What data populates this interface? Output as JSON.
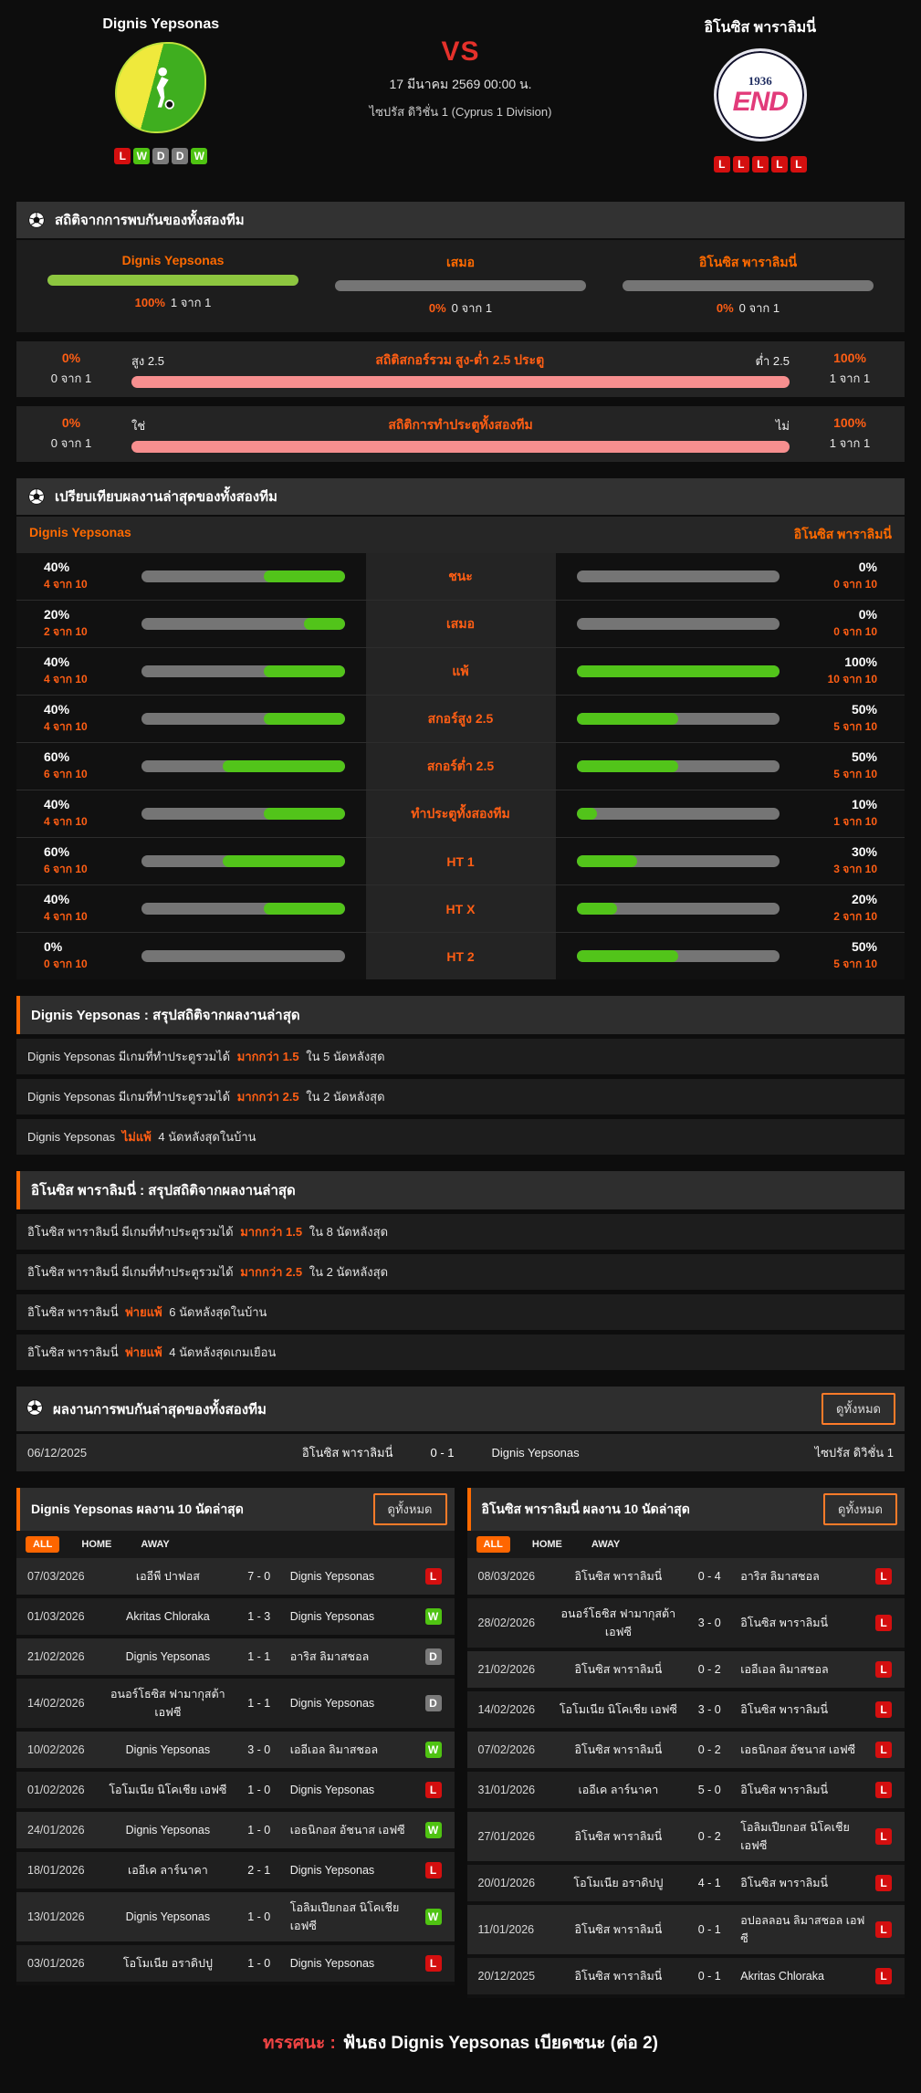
{
  "colors": {
    "accent": "#ff6a00",
    "green": "#52c41a",
    "green_light": "#8dc63f",
    "gray_bar": "#757575",
    "pink": "#f78f8f",
    "win": "#4fc312",
    "loss": "#d40f0f",
    "draw": "#7a7a7a",
    "vs_red": "#e5312b"
  },
  "header": {
    "home": {
      "name": "Dignis Yepsonas",
      "form": [
        "L",
        "W",
        "D",
        "D",
        "W"
      ]
    },
    "away": {
      "name": "อิโนซิส พาราลิมนี่",
      "form": [
        "L",
        "L",
        "L",
        "L",
        "L"
      ],
      "logo_year": "1936",
      "logo_text": "END"
    },
    "vs": "VS",
    "datetime": "17 มีนาคม 2569 00:00 น.",
    "league": "ไซปรัส ดิวิชั่น 1 (Cyprus 1 Division)"
  },
  "h2h_stats": {
    "title": "สถิติจากการพบกันของทั้งสองทีม",
    "columns": [
      {
        "label": "Dignis Yepsonas",
        "pct": "100%",
        "count": "1 จาก 1",
        "fill": 100,
        "fill_color": "#8dc63f"
      },
      {
        "label": "เสมอ",
        "pct": "0%",
        "count": "0 จาก 1",
        "fill": 0,
        "fill_color": "#8dc63f"
      },
      {
        "label": "อิโนซิส พาราลิมนี่",
        "pct": "0%",
        "count": "0 จาก 1",
        "fill": 0,
        "fill_color": "#8dc63f"
      }
    ],
    "ou_row": {
      "title": "สถิติสกอร์รวม สูง-ต่ำ 2.5 ประตู",
      "left_pct": "0%",
      "left_count": "0 จาก 1",
      "left_label": "สูง 2.5",
      "right_label": "ต่ำ 2.5",
      "right_pct": "100%",
      "right_count": "1 จาก 1"
    },
    "btts_row": {
      "title": "สถิติการทำประตูทั้งสองทีม",
      "left_pct": "0%",
      "left_count": "0 จาก 1",
      "left_label": "ใช่",
      "right_label": "ไม่",
      "right_pct": "100%",
      "right_count": "1 จาก 1"
    }
  },
  "comparison": {
    "title": "เปรียบเทียบผลงานล่าสุดของทั้งสองทีม",
    "home_name": "Dignis Yepsonas",
    "away_name": "อิโนซิส พาราลิมนี่",
    "rows": [
      {
        "label": "ชนะ",
        "home_pct": "40%",
        "home_count": "4 จาก 10",
        "home_fill": 40,
        "away_pct": "0%",
        "away_count": "0 จาก 10",
        "away_fill": 0
      },
      {
        "label": "เสมอ",
        "home_pct": "20%",
        "home_count": "2 จาก 10",
        "home_fill": 20,
        "away_pct": "0%",
        "away_count": "0 จาก 10",
        "away_fill": 0
      },
      {
        "label": "แพ้",
        "home_pct": "40%",
        "home_count": "4 จาก 10",
        "home_fill": 40,
        "away_pct": "100%",
        "away_count": "10 จาก 10",
        "away_fill": 100
      },
      {
        "label": "สกอร์สูง 2.5",
        "home_pct": "40%",
        "home_count": "4 จาก 10",
        "home_fill": 40,
        "away_pct": "50%",
        "away_count": "5 จาก 10",
        "away_fill": 50
      },
      {
        "label": "สกอร์ต่ำ 2.5",
        "home_pct": "60%",
        "home_count": "6 จาก 10",
        "home_fill": 60,
        "away_pct": "50%",
        "away_count": "5 จาก 10",
        "away_fill": 50
      },
      {
        "label": "ทำประตูทั้งสองทีม",
        "home_pct": "40%",
        "home_count": "4 จาก 10",
        "home_fill": 40,
        "away_pct": "10%",
        "away_count": "1 จาก 10",
        "away_fill": 10
      },
      {
        "label": "HT 1",
        "home_pct": "60%",
        "home_count": "6 จาก 10",
        "home_fill": 60,
        "away_pct": "30%",
        "away_count": "3 จาก 10",
        "away_fill": 30
      },
      {
        "label": "HT X",
        "home_pct": "40%",
        "home_count": "4 จาก 10",
        "home_fill": 40,
        "away_pct": "20%",
        "away_count": "2 จาก 10",
        "away_fill": 20
      },
      {
        "label": "HT 2",
        "home_pct": "0%",
        "home_count": "0 จาก 10",
        "home_fill": 0,
        "away_pct": "50%",
        "away_count": "5 จาก 10",
        "away_fill": 50
      }
    ]
  },
  "home_summary": {
    "title": "Dignis Yepsonas : สรุปสถิติจากผลงานล่าสุด",
    "rows": [
      {
        "pre": "Dignis Yepsonas มีเกมที่ทำประตูรวมได้",
        "highlight": "มากกว่า 1.5",
        "post": "ใน 5 นัดหลังสุด"
      },
      {
        "pre": "Dignis Yepsonas มีเกมที่ทำประตูรวมได้",
        "highlight": "มากกว่า 2.5",
        "post": "ใน 2 นัดหลังสุด"
      },
      {
        "pre": "Dignis Yepsonas",
        "highlight": "ไม่แพ้",
        "post": "4 นัดหลังสุดในบ้าน"
      }
    ]
  },
  "away_summary": {
    "title": "อิโนซิส พาราลิมนี่ : สรุปสถิติจากผลงานล่าสุด",
    "rows": [
      {
        "pre": "อิโนซิส พาราลิมนี่ มีเกมที่ทำประตูรวมได้",
        "highlight": "มากกว่า 1.5",
        "post": "ใน 8 นัดหลังสุด"
      },
      {
        "pre": "อิโนซิส พาราลิมนี่ มีเกมที่ทำประตูรวมได้",
        "highlight": "มากกว่า 2.5",
        "post": "ใน 2 นัดหลังสุด"
      },
      {
        "pre": "อิโนซิส พาราลิมนี่",
        "highlight": "พ่ายแพ้",
        "post": "6 นัดหลังสุดในบ้าน"
      },
      {
        "pre": "อิโนซิส พาราลิมนี่",
        "highlight": "พ่ายแพ้",
        "post": "4 นัดหลังสุดเกมเยือน"
      }
    ]
  },
  "h2h_matches": {
    "title": "ผลงานการพบกันล่าสุดของทั้งสองทีม",
    "view_all": "ดูทั้งหมด",
    "rows": [
      {
        "date": "06/12/2025",
        "home": "อิโนซิส พาราลิมนี่",
        "score": "0 - 1",
        "away": "Dignis Yepsonas",
        "league": "ไซปรัส ดิวิชั่น 1"
      }
    ]
  },
  "home_recent": {
    "title": "Dignis Yepsonas ผลงาน 10 นัดล่าสุด",
    "view_all": "ดูทั้งหมด",
    "tabs": [
      "ALL",
      "HOME",
      "AWAY"
    ],
    "rows": [
      {
        "date": "07/03/2026",
        "home": "เออีพี ปาฟอส",
        "score": "7 - 0",
        "away": "Dignis Yepsonas",
        "result": "L"
      },
      {
        "date": "01/03/2026",
        "home": "Akritas Chloraka",
        "score": "1 - 3",
        "away": "Dignis Yepsonas",
        "result": "W"
      },
      {
        "date": "21/02/2026",
        "home": "Dignis Yepsonas",
        "score": "1 - 1",
        "away": "อาริส ลิมาสชอล",
        "result": "D"
      },
      {
        "date": "14/02/2026",
        "home": "อนอร์โธซิส ฟามากุสต้า เอฟซี",
        "score": "1 - 1",
        "away": "Dignis Yepsonas",
        "result": "D"
      },
      {
        "date": "10/02/2026",
        "home": "Dignis Yepsonas",
        "score": "3 - 0",
        "away": "เออีเอล ลิมาสชอล",
        "result": "W"
      },
      {
        "date": "01/02/2026",
        "home": "โอโมเนีย นิโคเชีย เอฟซี",
        "score": "1 - 0",
        "away": "Dignis Yepsonas",
        "result": "L"
      },
      {
        "date": "24/01/2026",
        "home": "Dignis Yepsonas",
        "score": "1 - 0",
        "away": "เอธนิกอส อัชนาส เอฟซี",
        "result": "W"
      },
      {
        "date": "18/01/2026",
        "home": "เออีเค ลาร์นาคา",
        "score": "2 - 1",
        "away": "Dignis Yepsonas",
        "result": "L"
      },
      {
        "date": "13/01/2026",
        "home": "Dignis Yepsonas",
        "score": "1 - 0",
        "away": "โอลิมเปียกอส นิโคเชีย เอฟซี",
        "result": "W"
      },
      {
        "date": "03/01/2026",
        "home": "โอโมเนีย อราดิปปู",
        "score": "1 - 0",
        "away": "Dignis Yepsonas",
        "result": "L"
      }
    ]
  },
  "away_recent": {
    "title": "อิโนซิส พาราลิมนี่ ผลงาน 10 นัดล่าสุด",
    "view_all": "ดูทั้งหมด",
    "tabs": [
      "ALL",
      "HOME",
      "AWAY"
    ],
    "rows": [
      {
        "date": "08/03/2026",
        "home": "อิโนซิส พาราลิมนี่",
        "score": "0 - 4",
        "away": "อาริส ลิมาสชอล",
        "result": "L"
      },
      {
        "date": "28/02/2026",
        "home": "อนอร์โธซิส ฟามากุสต้า เอฟซี",
        "score": "3 - 0",
        "away": "อิโนซิส พาราลิมนี่",
        "result": "L"
      },
      {
        "date": "21/02/2026",
        "home": "อิโนซิส พาราลิมนี่",
        "score": "0 - 2",
        "away": "เออีเอล ลิมาสชอล",
        "result": "L"
      },
      {
        "date": "14/02/2026",
        "home": "โอโมเนีย นิโคเชีย เอฟซี",
        "score": "3 - 0",
        "away": "อิโนซิส พาราลิมนี่",
        "result": "L"
      },
      {
        "date": "07/02/2026",
        "home": "อิโนซิส พาราลิมนี่",
        "score": "0 - 2",
        "away": "เอธนิกอส อัชนาส เอฟซี",
        "result": "L"
      },
      {
        "date": "31/01/2026",
        "home": "เออีเค ลาร์นาคา",
        "score": "5 - 0",
        "away": "อิโนซิส พาราลิมนี่",
        "result": "L"
      },
      {
        "date": "27/01/2026",
        "home": "อิโนซิส พาราลิมนี่",
        "score": "0 - 2",
        "away": "โอลิมเปียกอส นิโคเชีย เอฟซี",
        "result": "L"
      },
      {
        "date": "20/01/2026",
        "home": "โอโมเนีย อราดิปปู",
        "score": "4 - 1",
        "away": "อิโนซิส พาราลิมนี่",
        "result": "L"
      },
      {
        "date": "11/01/2026",
        "home": "อิโนซิส พาราลิมนี่",
        "score": "0 - 1",
        "away": "อปอลลอน ลิมาสชอล เอฟซี",
        "result": "L"
      },
      {
        "date": "20/12/2025",
        "home": "อิโนซิส พาราลิมนี่",
        "score": "0 - 1",
        "away": "Akritas Chloraka",
        "result": "L"
      }
    ]
  },
  "footer": {
    "label": "ทรรศนะ :",
    "text": "ฟันธง Dignis Yepsonas เบียดชนะ (ต่อ 2)"
  }
}
